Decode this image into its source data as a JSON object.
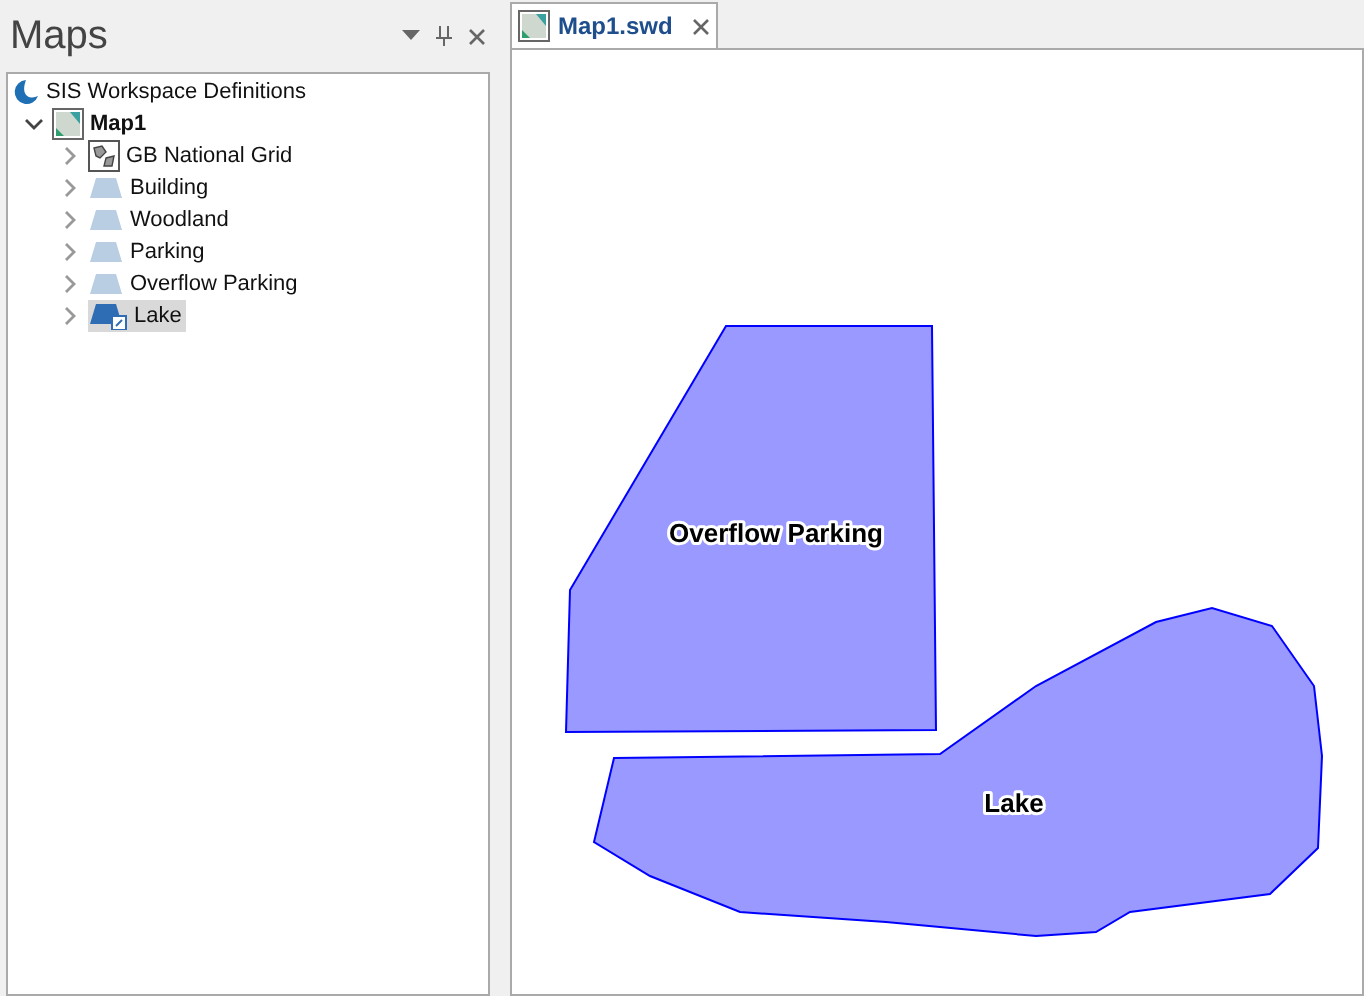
{
  "panel": {
    "title": "Maps"
  },
  "tree": [
    {
      "label": "SIS Workspace Definitions",
      "kind": "workspace",
      "children": [
        {
          "label": "Map1",
          "kind": "map",
          "expanded": true,
          "children": [
            {
              "label": "GB National Grid",
              "kind": "grid",
              "expanded": false,
              "selected": false
            },
            {
              "label": "Building",
              "kind": "layer",
              "expanded": false,
              "selected": false
            },
            {
              "label": "Woodland",
              "kind": "layer",
              "expanded": false,
              "selected": false
            },
            {
              "label": "Parking",
              "kind": "layer",
              "expanded": false,
              "selected": false
            },
            {
              "label": "Overflow Parking",
              "kind": "layer",
              "expanded": false,
              "selected": false
            },
            {
              "label": "Lake",
              "kind": "linked-layer",
              "expanded": false,
              "selected": true
            }
          ]
        }
      ]
    }
  ],
  "tabs": [
    {
      "label": "Map1.swd",
      "selected": true
    }
  ],
  "map": {
    "features": [
      {
        "label": "Overflow Parking",
        "color": "#9999ff"
      },
      {
        "label": "Lake",
        "color": "#9999ff"
      }
    ]
  }
}
